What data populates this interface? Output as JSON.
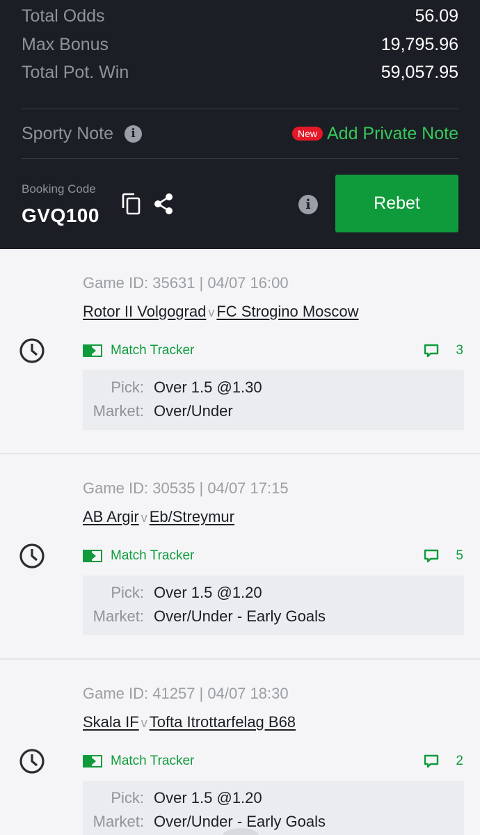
{
  "summary": {
    "total_odds": {
      "label": "Total Odds",
      "value": "56.09"
    },
    "max_bonus": {
      "label": "Max Bonus",
      "value": "19,795.96"
    },
    "total_pot_win": {
      "label": "Total Pot. Win",
      "value": "59,057.95"
    }
  },
  "note": {
    "label": "Sporty Note",
    "new_badge": "New",
    "add_private_note": "Add Private Note"
  },
  "booking": {
    "label": "Booking Code",
    "code": "GVQ100",
    "rebet_label": "Rebet"
  },
  "colors": {
    "dark_bg": "#1b1e25",
    "brand_green": "#0f9b3b",
    "light_green": "#38c85a",
    "badge_red": "#e41827"
  },
  "games": [
    {
      "id_line": "Game ID: 35631 | 04/07 16:00",
      "home": "Rotor II Volgograd",
      "vs": "v",
      "away": "FC Strogino Moscow",
      "tracker": "Match Tracker",
      "comments": "3",
      "pick_label": "Pick:",
      "pick": "Over 1.5 @1.30",
      "market_label": "Market:",
      "market": "Over/Under"
    },
    {
      "id_line": "Game ID: 30535 | 04/07 17:15",
      "home": "AB Argir",
      "vs": "v",
      "away": "Eb/Streymur",
      "tracker": "Match Tracker",
      "comments": "5",
      "pick_label": "Pick:",
      "pick": "Over 1.5 @1.20",
      "market_label": "Market:",
      "market": "Over/Under - Early Goals"
    },
    {
      "id_line": "Game ID: 41257 | 04/07 18:30",
      "home": "Skala IF",
      "vs": "v",
      "away": "Tofta Itrottarfelag B68",
      "tracker": "Match Tracker",
      "comments": "2",
      "pick_label": "Pick:",
      "pick": "Over 1.5 @1.20",
      "market_label": "Market:",
      "market": "Over/Under - Early Goals"
    }
  ],
  "icons": {
    "info": "info-icon",
    "copy": "copy-icon",
    "share": "share-icon",
    "clock": "clock-icon",
    "tracker": "match-tracker-icon",
    "comment": "comment-icon"
  }
}
